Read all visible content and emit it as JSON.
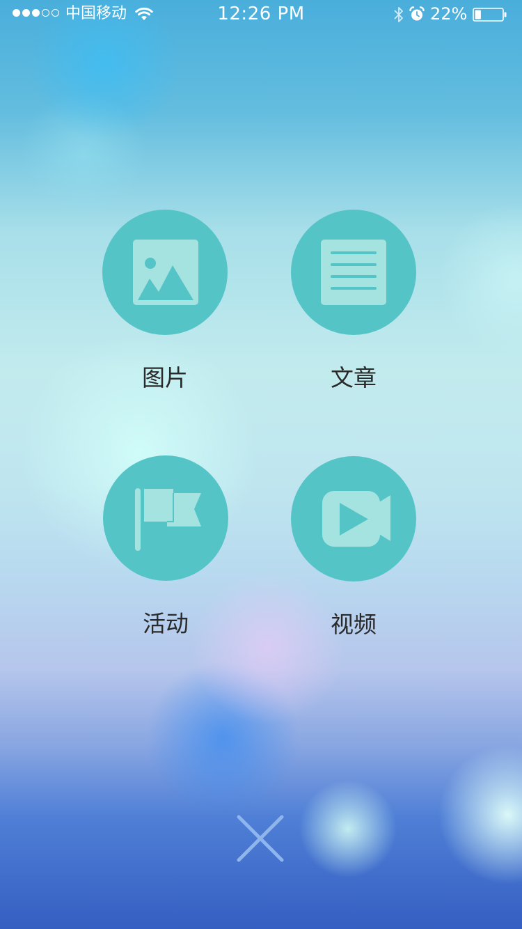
{
  "status_bar": {
    "carrier": "中国移动",
    "time": "12:26 PM",
    "battery_percent": "22%",
    "battery_level": 0.22,
    "signal_bars_filled": 3,
    "signal_bars_total": 5,
    "icons": [
      "signal-dots-icon",
      "wifi-icon",
      "bluetooth-icon",
      "alarm-clock-icon",
      "battery-icon"
    ]
  },
  "menu": {
    "items": [
      {
        "id": "photos",
        "label": "图片",
        "icon": "image-icon"
      },
      {
        "id": "article",
        "label": "文章",
        "icon": "article-icon"
      },
      {
        "id": "event",
        "label": "活动",
        "icon": "flag-icon"
      },
      {
        "id": "video",
        "label": "视频",
        "icon": "video-camera-icon"
      }
    ]
  },
  "close_button": {
    "icon": "close-icon"
  },
  "colors": {
    "circle": "#55c4c6",
    "icon_fill": "#a5e3e0",
    "label_text": "#2a2a2a",
    "close_icon": "#8fb6ec",
    "status_text": "#ffffff"
  }
}
